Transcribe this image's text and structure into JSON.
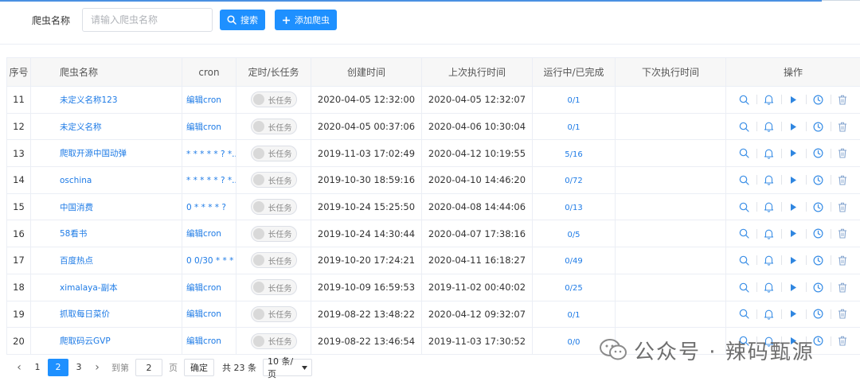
{
  "search": {
    "label": "爬虫名称",
    "placeholder": "请输入爬虫名称",
    "search_button": "搜索",
    "add_button": "添加爬虫"
  },
  "table": {
    "headers": {
      "seq": "序号",
      "name": "爬虫名称",
      "cron": "cron",
      "task_type": "定时/长任务",
      "created": "创建时间",
      "last_run": "上次执行时间",
      "progress": "运行中/已完成",
      "next_run": "下次执行时间",
      "actions": "操作"
    },
    "switch_label": "长任务",
    "rows": [
      {
        "seq": "11",
        "name": "未定义名称123",
        "cron": "编辑cron",
        "created": "2020-04-05 12:32:00",
        "last_run": "2020-04-05 12:32:07",
        "progress": "0/1",
        "next_run": ""
      },
      {
        "seq": "12",
        "name": "未定义名称",
        "cron": "编辑cron",
        "created": "2020-04-05 00:37:06",
        "last_run": "2020-04-06 10:30:04",
        "progress": "0/1",
        "next_run": ""
      },
      {
        "seq": "13",
        "name": "爬取开源中国动弹",
        "cron": "* * * * * ? *...",
        "created": "2019-11-03 17:02:49",
        "last_run": "2020-04-12 10:19:55",
        "progress": "5/16",
        "next_run": ""
      },
      {
        "seq": "14",
        "name": "oschina",
        "cron": "* * * * * ? *...",
        "created": "2019-10-30 18:59:16",
        "last_run": "2020-04-10 14:46:20",
        "progress": "0/72",
        "next_run": ""
      },
      {
        "seq": "15",
        "name": "中国消费",
        "cron": "0 * * * * ?",
        "created": "2019-10-24 15:25:50",
        "last_run": "2020-04-08 14:44:06",
        "progress": "0/13",
        "next_run": ""
      },
      {
        "seq": "16",
        "name": "58看书",
        "cron": "编辑cron",
        "created": "2019-10-24 14:30:44",
        "last_run": "2020-04-07 17:38:16",
        "progress": "0/5",
        "next_run": ""
      },
      {
        "seq": "17",
        "name": "百度热点",
        "cron": "0 0/30 * * * ?",
        "created": "2019-10-20 17:24:21",
        "last_run": "2020-04-11 16:18:27",
        "progress": "0/49",
        "next_run": ""
      },
      {
        "seq": "18",
        "name": "ximalaya-副本",
        "cron": "编辑cron",
        "created": "2019-10-09 16:59:53",
        "last_run": "2019-11-02 00:40:02",
        "progress": "0/25",
        "next_run": ""
      },
      {
        "seq": "19",
        "name": "抓取每日菜价",
        "cron": "编辑cron",
        "created": "2019-08-22 13:48:22",
        "last_run": "2020-04-12 09:32:07",
        "progress": "0/1",
        "next_run": ""
      },
      {
        "seq": "20",
        "name": "爬取码云GVP",
        "cron": "编辑cron",
        "created": "2019-08-22 13:46:54",
        "last_run": "2019-11-03 17:30:52",
        "progress": "0/0",
        "next_run": ""
      }
    ]
  },
  "pagination": {
    "prev": "‹",
    "next": "›",
    "pages": [
      "1",
      "2",
      "3"
    ],
    "current_page": "2",
    "goto_label": "到第",
    "goto_value": "2",
    "page_unit": "页",
    "confirm": "确定",
    "total": "共 23 条",
    "page_size": "10 条/页"
  },
  "watermark": {
    "text": "公众号 · 辣码甄源"
  },
  "colors": {
    "primary": "#1e90ff",
    "link": "#1e7be6",
    "header_bg": "#f7f7f7",
    "border": "#ebeef5"
  },
  "icons": {
    "actions": [
      "search-icon",
      "bell-icon",
      "play-icon",
      "clock-icon",
      "trash-icon"
    ]
  }
}
